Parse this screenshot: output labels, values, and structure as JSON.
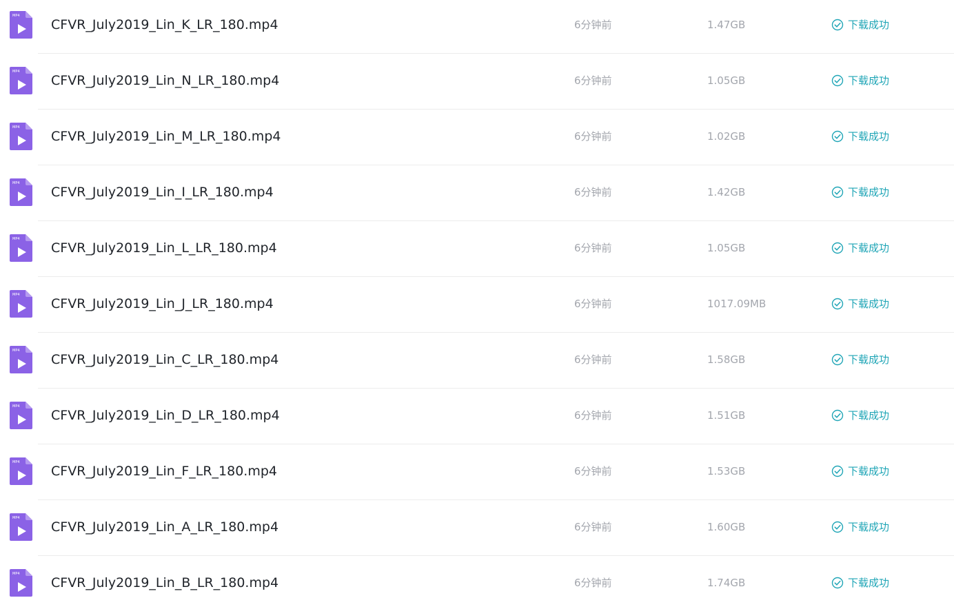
{
  "colors": {
    "icon_purple": "#8b62e6",
    "icon_fold": "#b59af0",
    "status_teal": "#1fa5b6",
    "meta_gray": "#a3a6ad",
    "name_dark": "#1f2329"
  },
  "files": [
    {
      "name": "CFVR_July2019_Lin_K_LR_180.mp4",
      "time": "6分钟前",
      "size": "1.47GB",
      "status": "下载成功",
      "icon": "mp4-file-icon",
      "icon_badge": "MP4"
    },
    {
      "name": "CFVR_July2019_Lin_N_LR_180.mp4",
      "time": "6分钟前",
      "size": "1.05GB",
      "status": "下载成功",
      "icon": "mp4-file-icon",
      "icon_badge": "MP4"
    },
    {
      "name": "CFVR_July2019_Lin_M_LR_180.mp4",
      "time": "6分钟前",
      "size": "1.02GB",
      "status": "下载成功",
      "icon": "mp4-file-icon",
      "icon_badge": "MP4"
    },
    {
      "name": "CFVR_July2019_Lin_I_LR_180.mp4",
      "time": "6分钟前",
      "size": "1.42GB",
      "status": "下载成功",
      "icon": "mp4-file-icon",
      "icon_badge": "MP4"
    },
    {
      "name": "CFVR_July2019_Lin_L_LR_180.mp4",
      "time": "6分钟前",
      "size": "1.05GB",
      "status": "下载成功",
      "icon": "mp4-file-icon",
      "icon_badge": "MP4"
    },
    {
      "name": "CFVR_July2019_Lin_J_LR_180.mp4",
      "time": "6分钟前",
      "size": "1017.09MB",
      "status": "下载成功",
      "icon": "mp4-file-icon",
      "icon_badge": "MP4"
    },
    {
      "name": "CFVR_July2019_Lin_C_LR_180.mp4",
      "time": "6分钟前",
      "size": "1.58GB",
      "status": "下载成功",
      "icon": "mp4-file-icon",
      "icon_badge": "MP4"
    },
    {
      "name": "CFVR_July2019_Lin_D_LR_180.mp4",
      "time": "6分钟前",
      "size": "1.51GB",
      "status": "下载成功",
      "icon": "mp4-file-icon",
      "icon_badge": "MP4"
    },
    {
      "name": "CFVR_July2019_Lin_F_LR_180.mp4",
      "time": "6分钟前",
      "size": "1.53GB",
      "status": "下载成功",
      "icon": "mp4-file-icon",
      "icon_badge": "MP4"
    },
    {
      "name": "CFVR_July2019_Lin_A_LR_180.mp4",
      "time": "6分钟前",
      "size": "1.60GB",
      "status": "下载成功",
      "icon": "mp4-file-icon",
      "icon_badge": "MP4"
    },
    {
      "name": "CFVR_July2019_Lin_B_LR_180.mp4",
      "time": "6分钟前",
      "size": "1.74GB",
      "status": "下载成功",
      "icon": "mp4-file-icon",
      "icon_badge": "MP4"
    }
  ]
}
